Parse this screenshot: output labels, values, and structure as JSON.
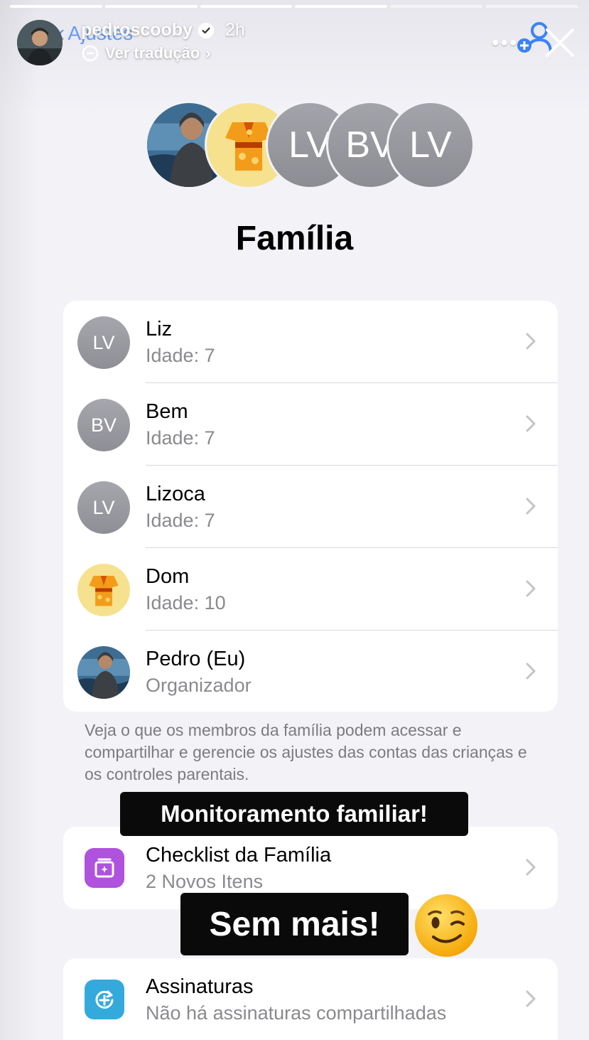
{
  "story": {
    "username": "pedroscooby",
    "time": "2h",
    "translate_label": "Ver tradução",
    "more_label": "•••",
    "progress_total": 6,
    "progress_done": 4
  },
  "settings_header": {
    "back_label": "Ajustes",
    "title": "Família",
    "header_avatar_initials": [
      "LV",
      "BV",
      "LV"
    ]
  },
  "members": [
    {
      "name": "Liz",
      "detail": "Idade: 7",
      "avatar": "LV",
      "type": "initials"
    },
    {
      "name": "Bem",
      "detail": "Idade: 7",
      "avatar": "BV",
      "type": "initials"
    },
    {
      "name": "Lizoca",
      "detail": "Idade: 7",
      "avatar": "LV",
      "type": "initials"
    },
    {
      "name": "Dom",
      "detail": "Idade: 10",
      "avatar": "kimono-icon",
      "type": "image"
    },
    {
      "name": "Pedro (Eu)",
      "detail": "Organizador",
      "avatar": "profile-photo",
      "type": "photo"
    }
  ],
  "footnote": "Veja o que os membros da família podem acessar e compartilhar e gerencie os ajustes das contas das crianças e os controles parentais.",
  "checklist": {
    "title": "Checklist da Família",
    "detail": "2 Novos Itens",
    "icon": "checklist-icon",
    "color": "#af52de"
  },
  "subscriptions": {
    "title": "Assinaturas",
    "detail": "Não há assinaturas compartilhadas",
    "icon": "subscriptions-icon",
    "color": "#34aadc"
  },
  "stickers": {
    "monitoring": "Monitoramento familiar!",
    "no_more": "Sem mais!",
    "emoji": "winking-face"
  },
  "colors": {
    "accent": "#3b82f6",
    "background": "#f2f2f7",
    "card": "#ffffff",
    "secondary_text": "#8a8a8e"
  }
}
